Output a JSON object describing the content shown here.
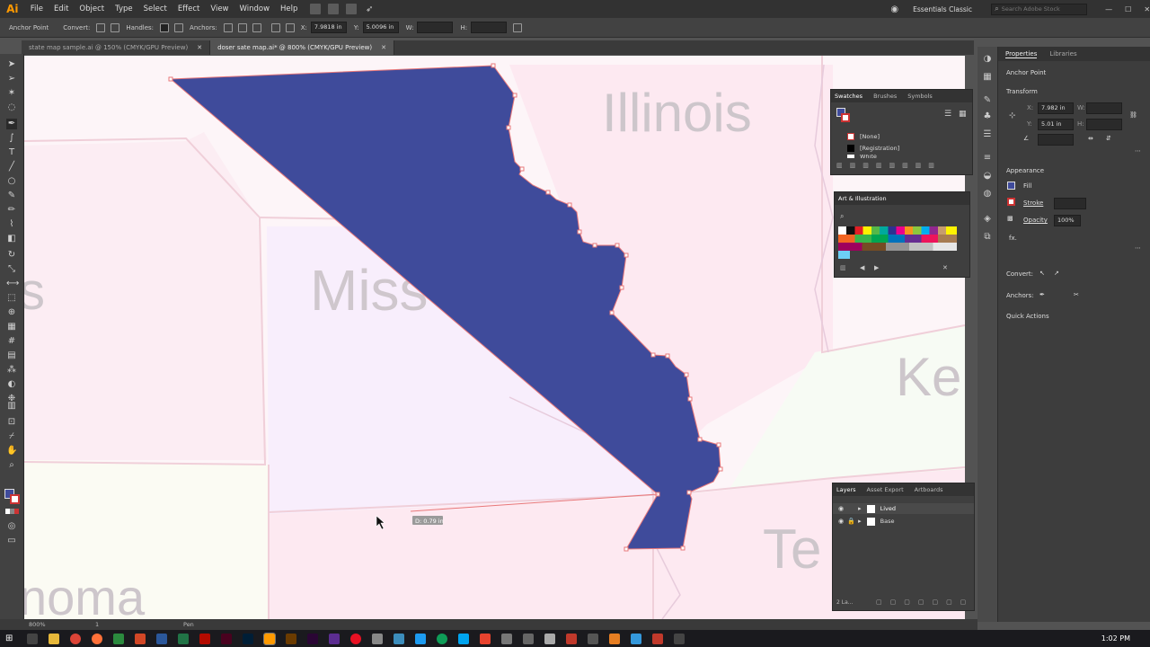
{
  "menubar": {
    "logo": "Ai",
    "items": [
      "File",
      "Edit",
      "Object",
      "Type",
      "Select",
      "Effect",
      "View",
      "Window",
      "Help"
    ],
    "workspace": "Essentials Classic",
    "search_placeholder": "Search Adobe Stock"
  },
  "control": {
    "tool_name": "Anchor Point",
    "convert_label": "Convert:",
    "handles_label": "Handles:",
    "anchors_label": "Anchors:",
    "x_label": "X:",
    "x_value": "7.9818 in",
    "y_label": "Y:",
    "y_value": "5.0096 in",
    "w_label": "W:",
    "h_label": "H:"
  },
  "tabs": [
    {
      "label": "state map sample.ai @ 150% (CMYK/GPU Preview)"
    },
    {
      "label": "doser sate map.ai* @ 800% (CMYK/GPU Preview)"
    }
  ],
  "canvas": {
    "labels": [
      "Illinois",
      "Miss",
      "Ke",
      "Te",
      "noma",
      "s"
    ],
    "shape_color": "#3f4b9b",
    "stroke_color": "#e8787a",
    "measure_label": "D: 0.79 in"
  },
  "swatches": {
    "tabs": [
      "Swatches",
      "Brushes",
      "Symbols"
    ],
    "items": [
      "[None]",
      "[Registration]",
      "White"
    ]
  },
  "art_illustration": {
    "title": "Art & Illustration"
  },
  "layers": {
    "tabs": [
      "Layers",
      "Asset Export",
      "Artboards"
    ],
    "items": [
      "Lived",
      "Base"
    ],
    "count_label": "2 La..."
  },
  "properties": {
    "tabs": [
      "Properties",
      "Libraries"
    ],
    "anchor_label": "Anchor Point",
    "transform_label": "Transform",
    "x_label": "X:",
    "x_value": "7.982 in",
    "y_label": "Y:",
    "y_value": "5.01 in",
    "w_label": "W:",
    "h_label": "H:",
    "appearance_label": "Appearance",
    "fill_label": "Fill",
    "stroke_label": "Stroke",
    "opacity_label": "Opacity",
    "opacity_value": "100%",
    "fx_label": "fx.",
    "convert_label": "Convert:",
    "anchors_label": "Anchors:",
    "quick_actions_label": "Quick Actions"
  },
  "status": {
    "zoom": "800%",
    "artboard": "1",
    "tool": "Pen"
  },
  "taskbar": {
    "time": "1:02 PM"
  },
  "colors": {
    "accent": "#ff9a00",
    "panel": "#3d3d3d",
    "selection": "#3f4b9b"
  }
}
